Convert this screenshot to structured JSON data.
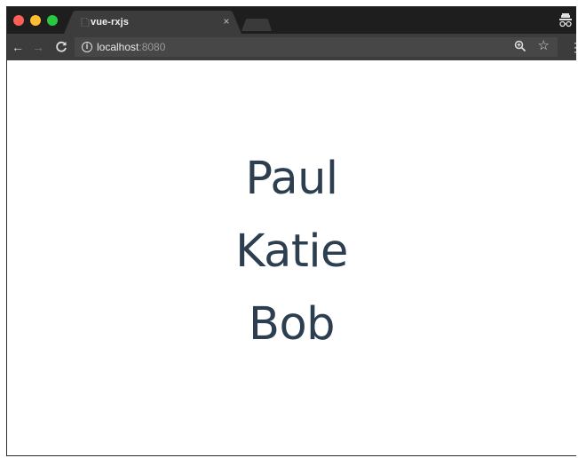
{
  "browser": {
    "tab": {
      "title": "vue-rxjs",
      "close_glyph": "×"
    },
    "toolbar": {
      "back_glyph": "←",
      "forward_glyph": "→",
      "reload_glyph": "C",
      "url_host": "localhost",
      "url_port": ":8080",
      "star_glyph": "☆",
      "menu_glyph": "⋮"
    },
    "icons": {
      "close": "close-icon",
      "back": "arrow-left-icon",
      "forward": "arrow-right-icon",
      "reload": "reload-icon",
      "info": "info-icon",
      "zoom": "zoom-icon",
      "bookmark": "star-icon",
      "menu": "kebab-menu-icon",
      "incognito": "incognito-icon"
    },
    "colors": {
      "close_dot": "#ff5f57",
      "minimize_dot": "#febc2e",
      "maximize_dot": "#28c840",
      "chrome_dark": "#1e1e1e",
      "toolbar": "#3c3c3c"
    }
  },
  "page": {
    "names": [
      "Paul",
      "Katie",
      "Bob"
    ],
    "text_color": "#2c3e50"
  }
}
